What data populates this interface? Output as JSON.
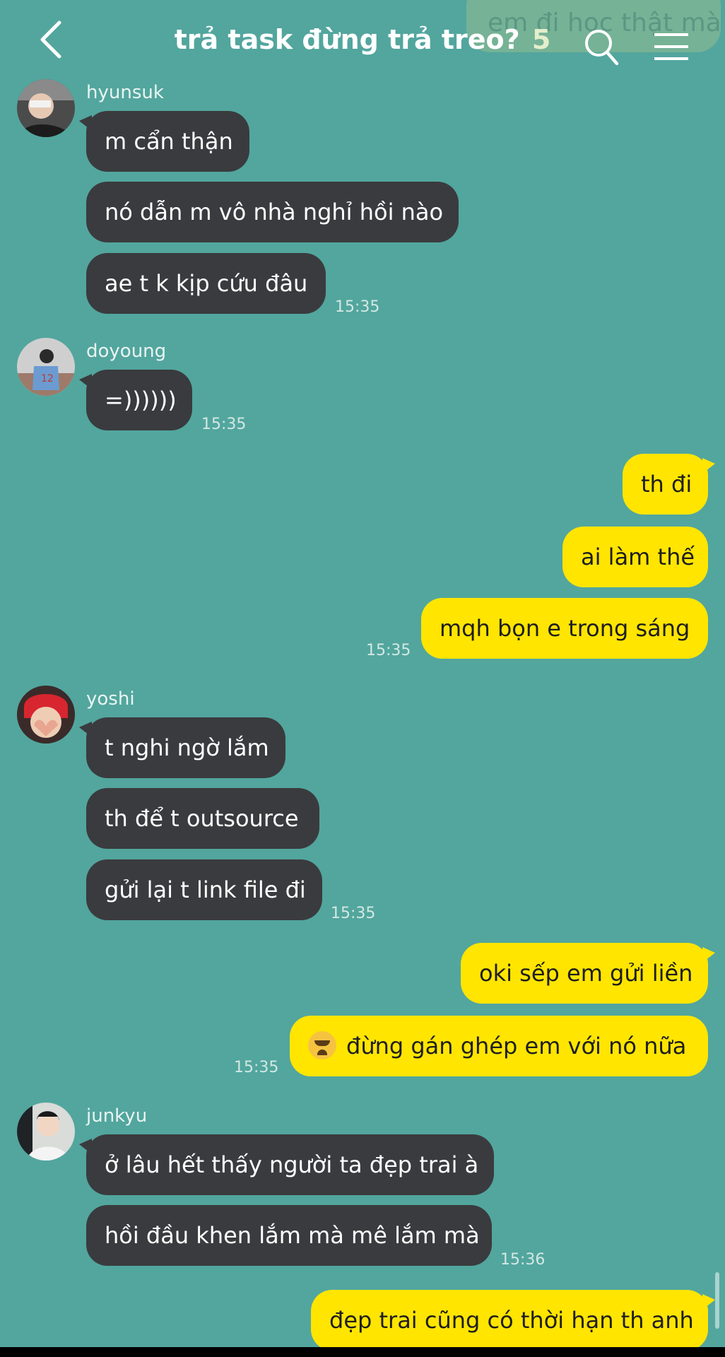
{
  "ghost_bubble": "em đi học thật mà",
  "header": {
    "title": "trả task đừng trả treo?",
    "count": "5",
    "back_icon": "chevron-left-icon",
    "search_icon": "search-icon",
    "menu_icon": "hamburger-menu-icon"
  },
  "colors": {
    "background": "#52a69e",
    "incoming_bubble": "#3a3b3e",
    "outgoing_bubble": "#ffe500"
  },
  "messages": {
    "hyunsuk": {
      "name": "hyunsuk",
      "texts": [
        "m cẩn thận",
        "nó dẫn m vô nhà nghỉ hồi nào",
        "ae t k kịp cứu đâu"
      ],
      "time": "15:35"
    },
    "doyoung": {
      "name": "doyoung",
      "texts": [
        "=))))))"
      ],
      "time": "15:35"
    },
    "me1": {
      "texts": [
        "th đi",
        "ai làm thế",
        "mqh bọn e trong sáng"
      ],
      "time": "15:35"
    },
    "yoshi": {
      "name": "yoshi",
      "texts": [
        "t nghi ngờ lắm",
        "th để t outsource",
        "gửi lại t link file đi"
      ],
      "time": "15:35"
    },
    "me2": {
      "texts": [
        "oki sếp em gửi liền",
        "đừng gán ghép em với nó nữa"
      ],
      "emoji": "loudly-crying-face",
      "time": "15:35"
    },
    "junkyu": {
      "name": "junkyu",
      "texts": [
        "ở lâu hết thấy người ta đẹp trai à",
        "hồi đầu khen lắm mà mê lắm mà"
      ],
      "time": "15:36"
    },
    "me3": {
      "texts": [
        "đẹp trai cũng có thời hạn th anh"
      ]
    }
  }
}
